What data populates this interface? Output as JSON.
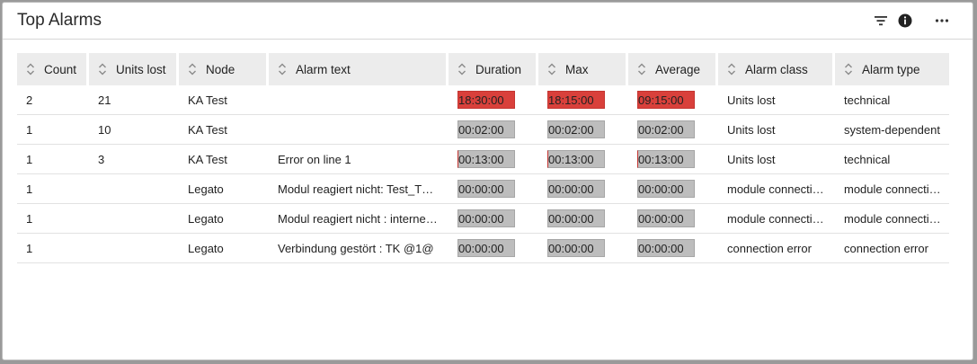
{
  "header": {
    "title": "Top Alarms"
  },
  "colors": {
    "alarm_red": "#d9403b",
    "bar_gray": "#bdbdbd"
  },
  "table": {
    "columns": [
      {
        "key": "count",
        "label": "Count"
      },
      {
        "key": "units_lost",
        "label": "Units lost"
      },
      {
        "key": "node",
        "label": "Node"
      },
      {
        "key": "alarm_text",
        "label": "Alarm text"
      },
      {
        "key": "duration",
        "label": "Duration"
      },
      {
        "key": "max",
        "label": "Max"
      },
      {
        "key": "average",
        "label": "Average"
      },
      {
        "key": "alarm_class",
        "label": "Alarm class"
      },
      {
        "key": "alarm_type",
        "label": "Alarm type"
      }
    ],
    "rows": [
      {
        "count": "2",
        "units_lost": "21",
        "node": "KA Test",
        "alarm_text": "",
        "duration": "18:30:00",
        "max": "18:15:00",
        "average": "09:15:00",
        "alarm_class": "Units lost",
        "alarm_type": "technical",
        "highlight": "red"
      },
      {
        "count": "1",
        "units_lost": "10",
        "node": "KA Test",
        "alarm_text": "",
        "duration": "00:02:00",
        "max": "00:02:00",
        "average": "00:02:00",
        "alarm_class": "Units lost",
        "alarm_type": "system-dependent",
        "highlight": "gray"
      },
      {
        "count": "1",
        "units_lost": "3",
        "node": "KA Test",
        "alarm_text": "Error on line 1",
        "duration": "00:13:00",
        "max": "00:13:00",
        "average": "00:13:00",
        "alarm_class": "Units lost",
        "alarm_type": "technical",
        "highlight": "gray-marked"
      },
      {
        "count": "1",
        "units_lost": "",
        "node": "Legato",
        "alarm_text": "Modul reagiert nicht: Test_T…",
        "duration": "00:00:00",
        "max": "00:00:00",
        "average": "00:00:00",
        "alarm_class": "module connecti…",
        "alarm_type": "module connecti…",
        "highlight": "gray"
      },
      {
        "count": "1",
        "units_lost": "",
        "node": "Legato",
        "alarm_text": "Modul reagiert nicht : interne…",
        "duration": "00:00:00",
        "max": "00:00:00",
        "average": "00:00:00",
        "alarm_class": "module connecti…",
        "alarm_type": "module connecti…",
        "highlight": "gray"
      },
      {
        "count": "1",
        "units_lost": "",
        "node": "Legato",
        "alarm_text": "Verbindung gestört : TK @1@",
        "duration": "00:00:00",
        "max": "00:00:00",
        "average": "00:00:00",
        "alarm_class": "connection error",
        "alarm_type": "connection error",
        "highlight": "gray"
      }
    ]
  }
}
